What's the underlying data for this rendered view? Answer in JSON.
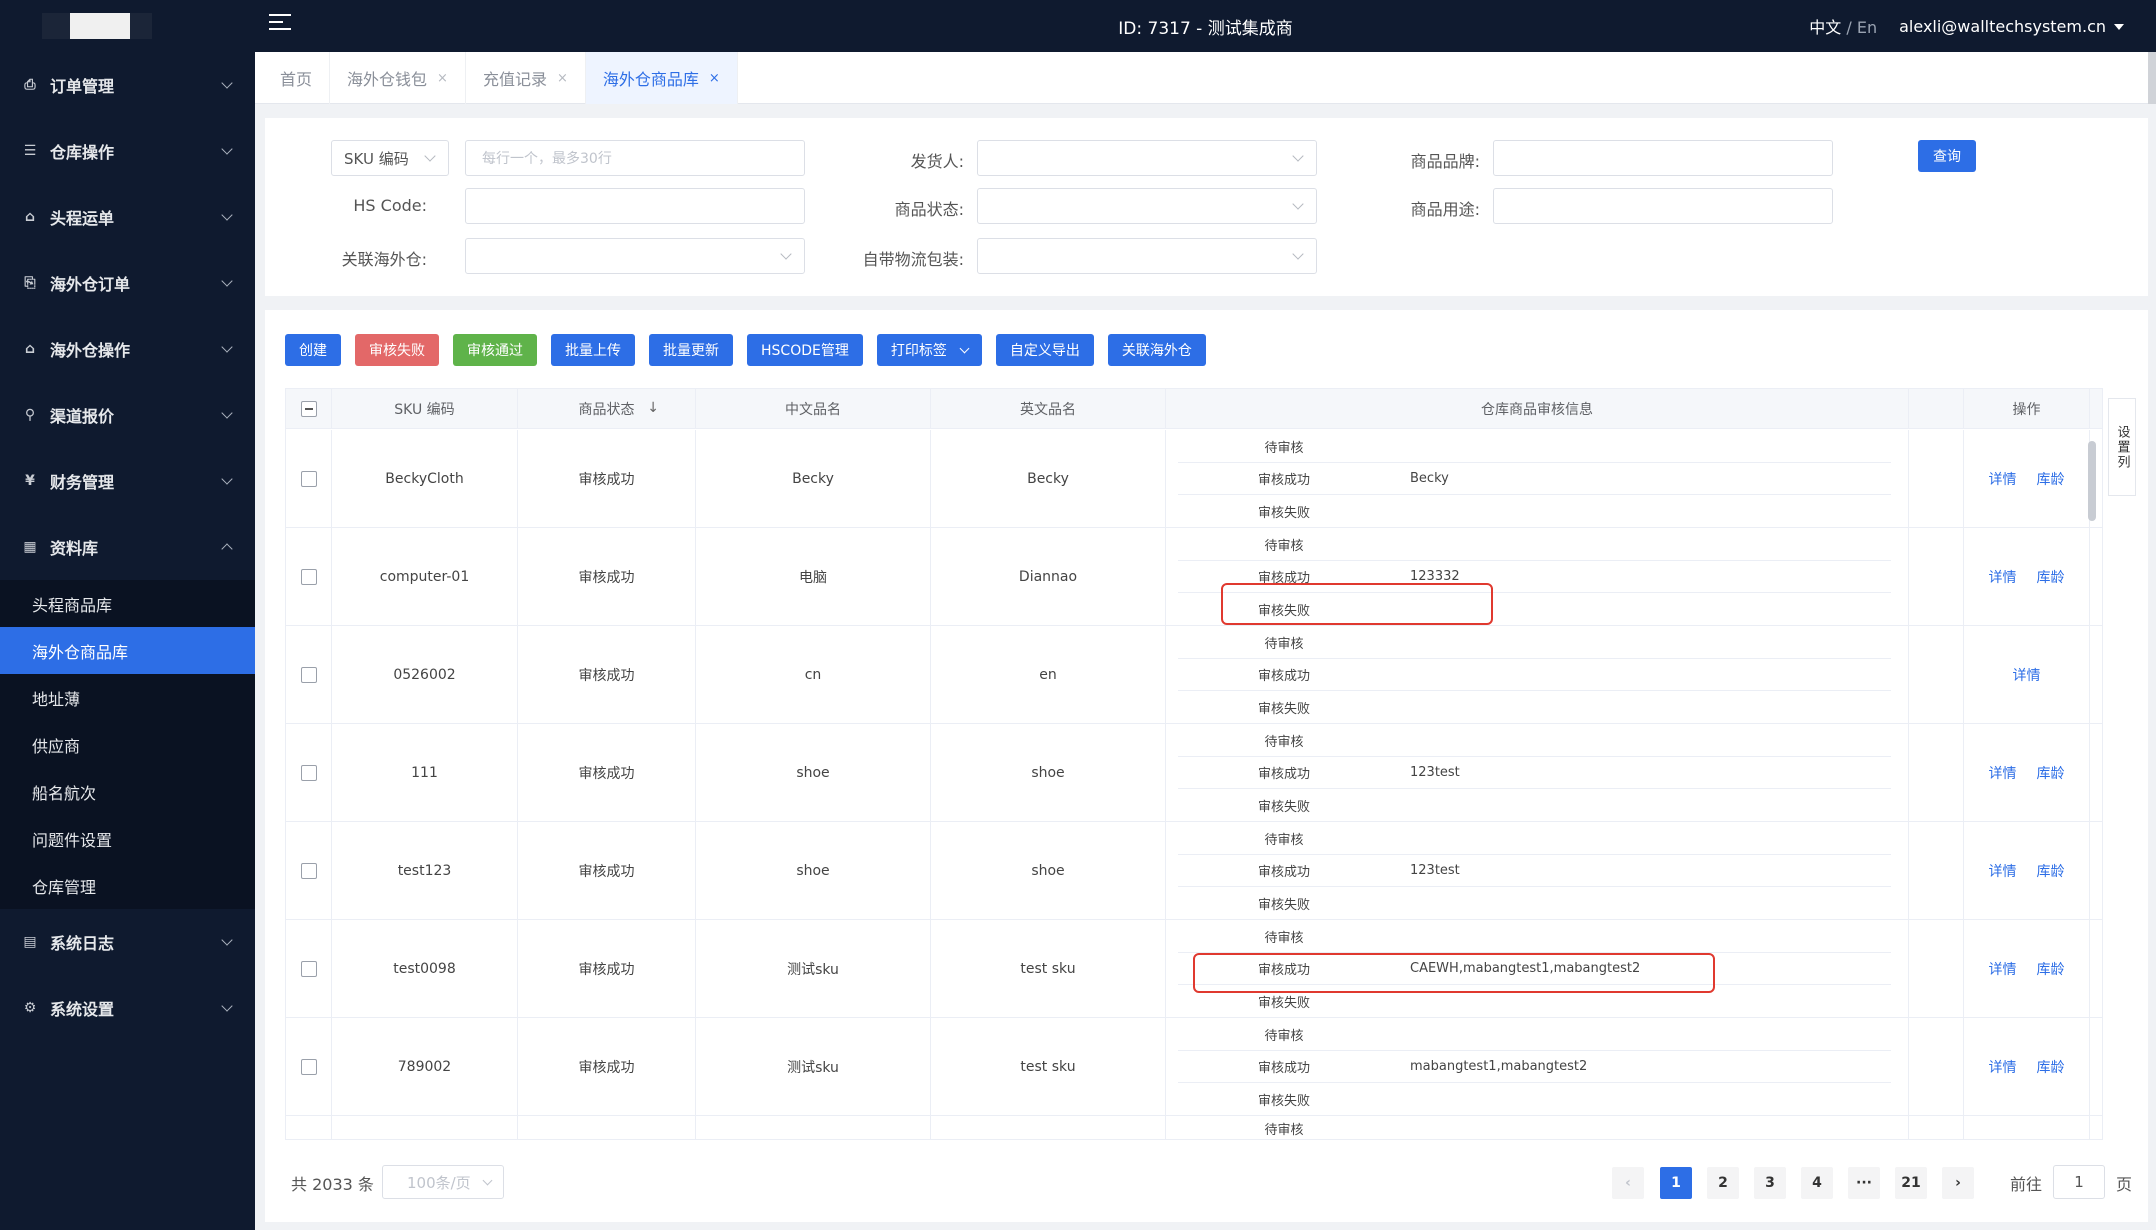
{
  "topbar": {
    "title": "ID: 7317 - 测试集成商",
    "lang_active": "中文",
    "lang_sep": " / ",
    "lang_other": "En",
    "user": "alexli@walltechsystem.cn"
  },
  "sidebar": {
    "menus": [
      {
        "label": "订单管理",
        "icon": "order-icon",
        "glyph": "⎙"
      },
      {
        "label": "仓库操作",
        "icon": "warehouse-icon",
        "glyph": "☰"
      },
      {
        "label": "头程运单",
        "icon": "waybill-icon",
        "glyph": "⌂"
      },
      {
        "label": "海外仓订单",
        "icon": "overseas-order-icon",
        "glyph": "⎘"
      },
      {
        "label": "海外仓操作",
        "icon": "overseas-ops-icon",
        "glyph": "⌂"
      },
      {
        "label": "渠道报价",
        "icon": "channel-icon",
        "glyph": "⚲"
      },
      {
        "label": "财务管理",
        "icon": "finance-icon",
        "glyph": "¥"
      },
      {
        "label": "资料库",
        "icon": "library-icon",
        "glyph": "▦"
      }
    ],
    "submenu": [
      "头程商品库",
      "海外仓商品库",
      "地址薄",
      "供应商",
      "船名航次",
      "问题件设置",
      "仓库管理"
    ],
    "bottom_menus": [
      {
        "label": "系统日志",
        "icon": "log-icon",
        "glyph": "▤"
      },
      {
        "label": "系统设置",
        "icon": "settings-icon",
        "glyph": "⚙"
      }
    ]
  },
  "tabs": [
    {
      "label": "首页",
      "closable": false
    },
    {
      "label": "海外仓钱包",
      "closable": true
    },
    {
      "label": "充值记录",
      "closable": true
    },
    {
      "label": "海外仓商品库",
      "closable": true
    }
  ],
  "filter": {
    "sku_select": "SKU 编码",
    "sku_placeholder": "每行一个，最多30行",
    "hs_label": "HS Code:",
    "warehouse_label": "关联海外仓:",
    "shipper_label": "发货人:",
    "status_label": "商品状态:",
    "packaging_label": "自带物流包装:",
    "brand_label": "商品品牌:",
    "usage_label": "商品用途:",
    "query_button": "查询"
  },
  "toolbar": [
    "创建",
    "审核失败",
    "审核通过",
    "批量上传",
    "批量更新",
    "HSCODE管理",
    "打印标签",
    "自定义导出",
    "关联海外仓"
  ],
  "table": {
    "headers": [
      "SKU 编码",
      "商品状态",
      "中文品名",
      "英文品名",
      "仓库商品审核信息",
      "操作"
    ],
    "sort_glyph": "↓",
    "audit_labels": [
      "待审核",
      "审核成功",
      "审核失败"
    ],
    "rows": [
      {
        "sku": "BeckyCloth",
        "status": "审核成功",
        "cn": "Becky",
        "en": "Becky",
        "approved": "Becky",
        "actions": [
          "详情",
          "库龄"
        ]
      },
      {
        "sku": "computer-01",
        "status": "审核成功",
        "cn": "电脑",
        "en": "Diannao",
        "approved": "123332",
        "actions": [
          "详情",
          "库龄"
        ]
      },
      {
        "sku": "0526002",
        "status": "审核成功",
        "cn": "cn",
        "en": "en",
        "approved": "",
        "actions": [
          "详情"
        ]
      },
      {
        "sku": "111",
        "status": "审核成功",
        "cn": "shoe",
        "en": "shoe",
        "approved": "123test",
        "actions": [
          "详情",
          "库龄"
        ]
      },
      {
        "sku": "test123",
        "status": "审核成功",
        "cn": "shoe",
        "en": "shoe",
        "approved": "123test",
        "actions": [
          "详情",
          "库龄"
        ]
      },
      {
        "sku": "test0098",
        "status": "审核成功",
        "cn": "测试sku",
        "en": "test sku",
        "approved": "CAEWH,mabangtest1,mabangtest2",
        "actions": [
          "详情",
          "库龄"
        ]
      },
      {
        "sku": "789002",
        "status": "审核成功",
        "cn": "测试sku",
        "en": "test sku",
        "approved": "mabangtest1,mabangtest2",
        "actions": [
          "详情",
          "库龄"
        ]
      }
    ],
    "partial_row_label": "待审核",
    "settings_column": "设置列"
  },
  "pagination": {
    "total": "共 2033 条",
    "page_size": "100条/页",
    "pages": [
      "1",
      "2",
      "3",
      "4",
      "···",
      "21"
    ],
    "prev": "‹",
    "next": "›",
    "goto_label": "前往",
    "goto_value": "1",
    "goto_suffix": "页"
  },
  "colors": {
    "accent": "#2d6ee6",
    "danger": "#e36868",
    "success": "#5fb34a",
    "highlight": "#e0392f",
    "sidebar_bg": "#0f1a2f"
  }
}
